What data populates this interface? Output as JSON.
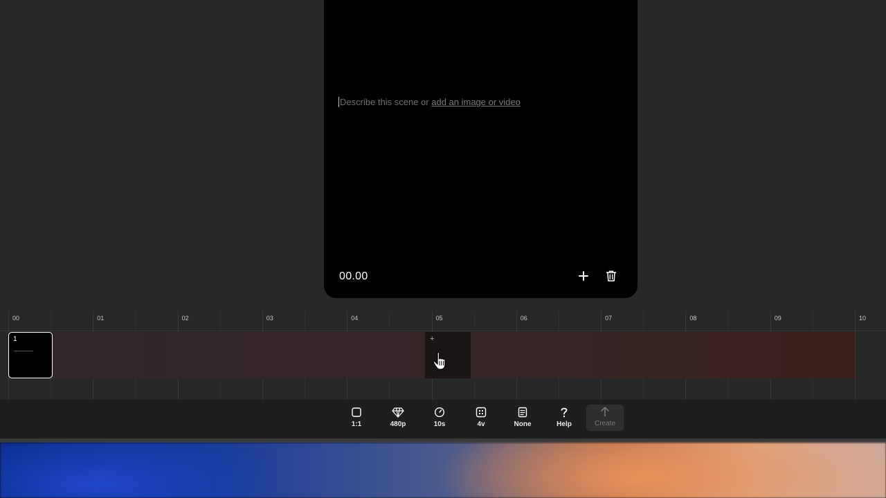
{
  "scene": {
    "prompt_placeholder": "Describe this scene or ",
    "prompt_link": "add an image or video",
    "timecode": "00.00",
    "add_icon": "plus-icon",
    "delete_icon": "trash-icon"
  },
  "timeline": {
    "ticks": [
      "00",
      "01",
      "02",
      "03",
      "04",
      "05",
      "06",
      "07",
      "08",
      "09",
      "10"
    ],
    "clip": {
      "number": "1"
    },
    "insert_label": "+",
    "cursor_icon": "hand-pointer-icon",
    "track_color_start": "#2f2729",
    "track_color_end": "#3a1e1a"
  },
  "toolbar": {
    "items": [
      {
        "label": "1:1",
        "icon": "square-icon"
      },
      {
        "label": "480p",
        "icon": "diamond-icon"
      },
      {
        "label": "10s",
        "icon": "timer-icon"
      },
      {
        "label": "4v",
        "icon": "grid-icon"
      },
      {
        "label": "None",
        "icon": "document-icon"
      },
      {
        "label": "Help",
        "icon": "question-icon"
      },
      {
        "label": "Create",
        "icon": "arrow-up-icon"
      }
    ]
  },
  "colors": {
    "background": "#272727",
    "card": "#000000",
    "toolbar": "#1e1e1e",
    "text": "#ffffff"
  }
}
